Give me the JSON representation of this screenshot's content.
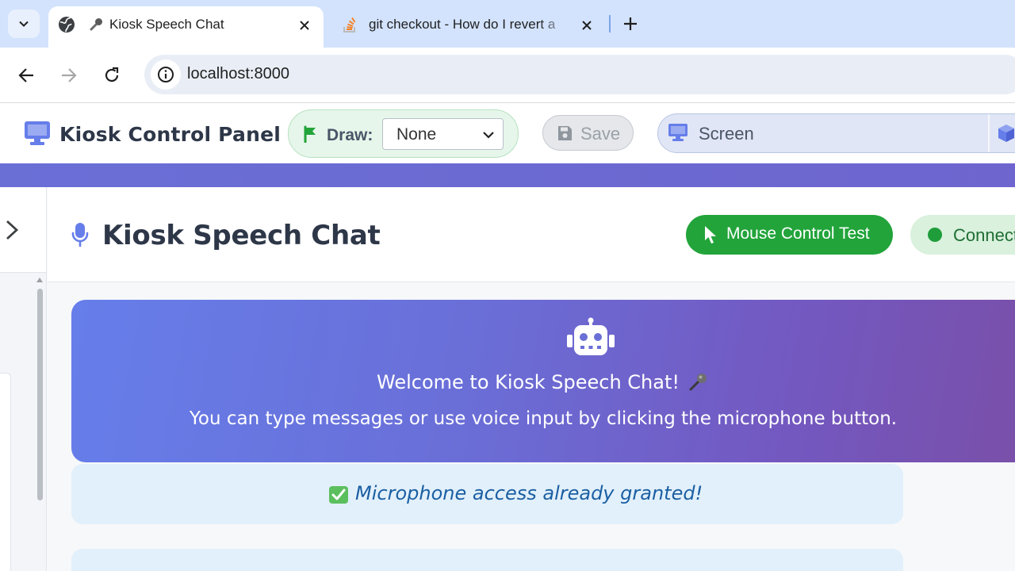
{
  "browser": {
    "tabs": [
      {
        "title": "Kiosk Speech Chat",
        "active": true
      },
      {
        "title": "git checkout - How do I revert a",
        "active": false
      }
    ],
    "address": {
      "url": "localhost:8000"
    }
  },
  "app": {
    "title": "Kiosk Control Panel",
    "draw": {
      "label": "Draw:",
      "selected": "None"
    },
    "save_label": "Save",
    "screen_label": "Screen"
  },
  "chat": {
    "title": "Kiosk Speech Chat",
    "mouse_test_label": "Mouse Control Test",
    "status_label": "Connect",
    "welcome_title": "Welcome to Kiosk Speech Chat!",
    "welcome_text": "You can type messages or use voice input by clicking the microphone button.",
    "mic_status": "Microphone access already granted!"
  },
  "colors": {
    "accent_purple": "#667eea",
    "mouse_button_green": "#22a43a",
    "status_green": "#1e9d3a",
    "info_blue": "#1b5fa3"
  }
}
